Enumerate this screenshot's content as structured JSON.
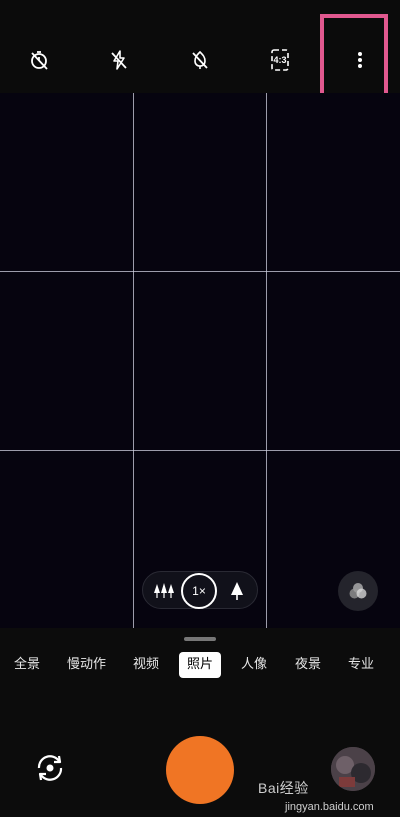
{
  "top_bar": {
    "timer": {
      "icon": "timer-off-icon"
    },
    "flash": {
      "icon": "flash-off-icon"
    },
    "ai_scene": {
      "icon": "ai-off-icon"
    },
    "aspect_ratio": {
      "label": "4:3",
      "icon": "aspect-ratio-icon"
    },
    "more": {
      "icon": "more-vertical-icon"
    }
  },
  "highlight_color": "#e0588f",
  "zoom": {
    "current": "1×",
    "wide_icon": "trees-icon",
    "tele_icon": "tree-icon"
  },
  "filters": {
    "icon": "filters-icon"
  },
  "modes": [
    {
      "label": "全景",
      "active": false
    },
    {
      "label": "慢动作",
      "active": false
    },
    {
      "label": "视频",
      "active": false
    },
    {
      "label": "照片",
      "active": true
    },
    {
      "label": "人像",
      "active": false
    },
    {
      "label": "夜景",
      "active": false
    },
    {
      "label": "专业",
      "active": false
    }
  ],
  "controls": {
    "switch_camera_icon": "switch-camera-icon",
    "shutter_color": "#f07524",
    "gallery_icon": "gallery-thumbnail"
  },
  "watermark": {
    "text": "Bai经验",
    "url": "jingyan.baidu.com"
  }
}
